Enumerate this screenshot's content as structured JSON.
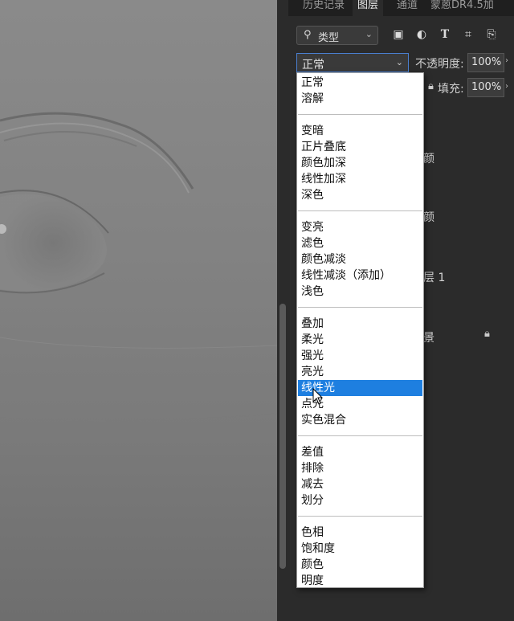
{
  "tabs": [
    {
      "label": "历史记录",
      "active": false
    },
    {
      "label": "图层",
      "active": true
    },
    {
      "label": "通道",
      "active": false
    },
    {
      "label": "蒙蒽DR4.5加",
      "active": false
    }
  ],
  "filter": {
    "search_icon": "search-icon",
    "label": "类型",
    "icons": [
      "image-layer-icon",
      "adjustment-icon",
      "text-layer-icon",
      "shape-layer-icon",
      "smart-object-icon"
    ]
  },
  "blend": {
    "current": "正常",
    "opacity_label": "不透明度:",
    "opacity_value": "100%",
    "fill_label": "填充:",
    "fill_value": "100%"
  },
  "layers_visible_fragments": [
    "颜",
    "颜",
    "层 1",
    "景"
  ],
  "blend_menu": {
    "groups": [
      [
        "正常",
        "溶解"
      ],
      [
        "变暗",
        "正片叠底",
        "颜色加深",
        "线性加深",
        "深色"
      ],
      [
        "变亮",
        "滤色",
        "颜色减淡",
        "线性减淡（添加）",
        "浅色"
      ],
      [
        "叠加",
        "柔光",
        "强光",
        "亮光",
        "线性光",
        "点光",
        "实色混合"
      ],
      [
        "差值",
        "排除",
        "减去",
        "划分"
      ],
      [
        "色相",
        "饱和度",
        "颜色",
        "明度"
      ]
    ],
    "highlighted": "线性光"
  },
  "colors": {
    "highlight": "#1e7fe0",
    "panel_bg": "#2b2b2b",
    "menu_bg": "#ffffff"
  }
}
